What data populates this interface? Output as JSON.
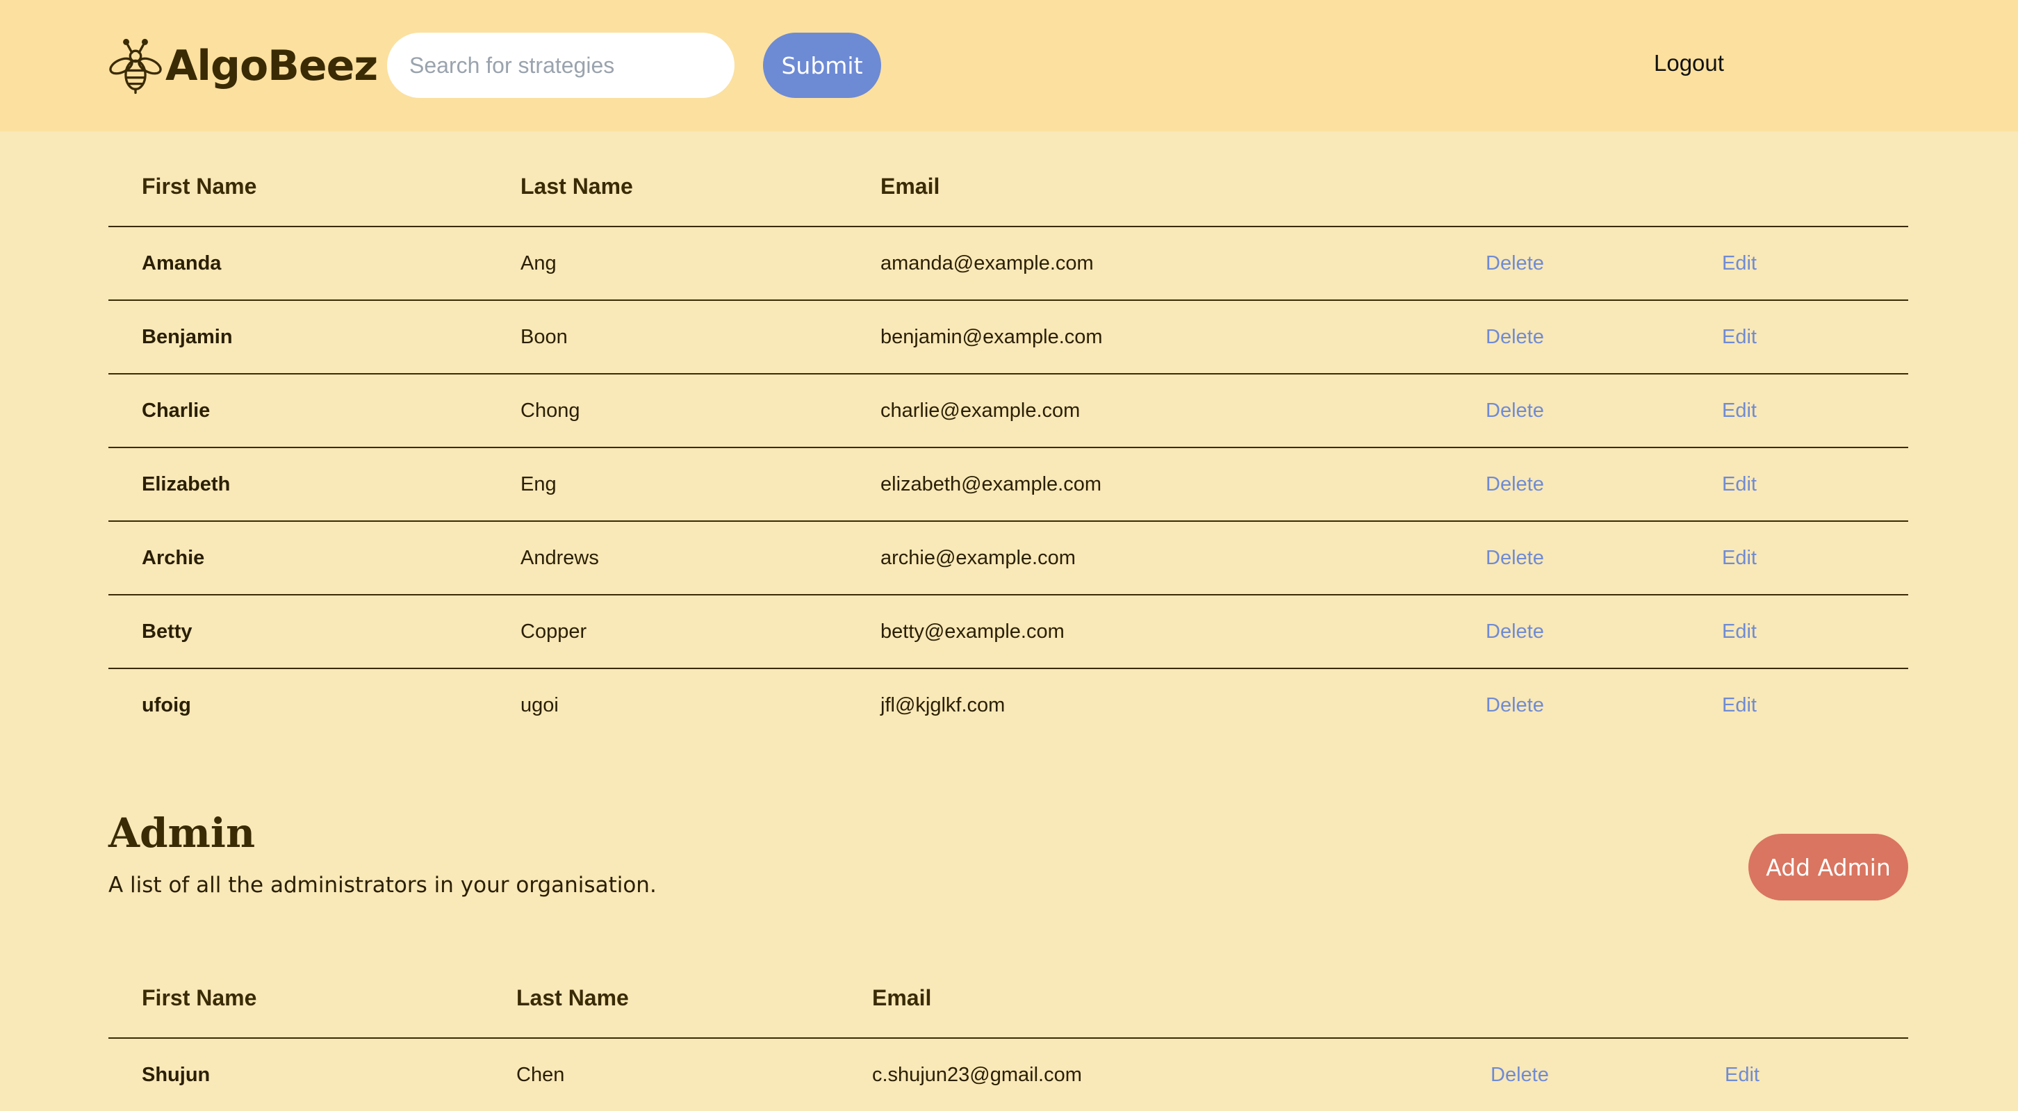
{
  "header": {
    "logo_text": "AlgoBeez",
    "search_placeholder": "Search for strategies",
    "submit_label": "Submit",
    "logout_label": "Logout"
  },
  "users_table": {
    "columns": [
      "First Name",
      "Last Name",
      "Email"
    ],
    "rows": [
      {
        "first": "Amanda",
        "last": "Ang",
        "email": "amanda@example.com",
        "delete": "Delete",
        "edit": "Edit"
      },
      {
        "first": "Benjamin",
        "last": "Boon",
        "email": "benjamin@example.com",
        "delete": "Delete",
        "edit": "Edit"
      },
      {
        "first": "Charlie",
        "last": "Chong",
        "email": "charlie@example.com",
        "delete": "Delete",
        "edit": "Edit"
      },
      {
        "first": "Elizabeth",
        "last": "Eng",
        "email": "elizabeth@example.com",
        "delete": "Delete",
        "edit": "Edit"
      },
      {
        "first": "Archie",
        "last": "Andrews",
        "email": "archie@example.com",
        "delete": "Delete",
        "edit": "Edit"
      },
      {
        "first": "Betty",
        "last": "Copper",
        "email": "betty@example.com",
        "delete": "Delete",
        "edit": "Edit"
      },
      {
        "first": "ufoig",
        "last": "ugoi",
        "email": "jfl@kjglkf.com",
        "delete": "Delete",
        "edit": "Edit"
      }
    ]
  },
  "admin_section": {
    "title": "Admin",
    "subtitle": "A list of all the administrators in your organisation.",
    "add_button_label": "Add Admin"
  },
  "admins_table": {
    "columns": [
      "First Name",
      "Last Name",
      "Email"
    ],
    "rows": [
      {
        "first": "Shujun",
        "last": "Chen",
        "email": "c.shujun23@gmail.com",
        "delete": "Delete",
        "edit": "Edit"
      }
    ]
  },
  "colors": {
    "header_bg": "#fbe09f",
    "page_bg": "#f9e8b8",
    "submit_button": "#6d8ad4",
    "add_admin_button": "#d97560",
    "link": "#6f8bd3",
    "text": "#3a2b05"
  },
  "icons": {
    "logo": "bee-icon"
  }
}
